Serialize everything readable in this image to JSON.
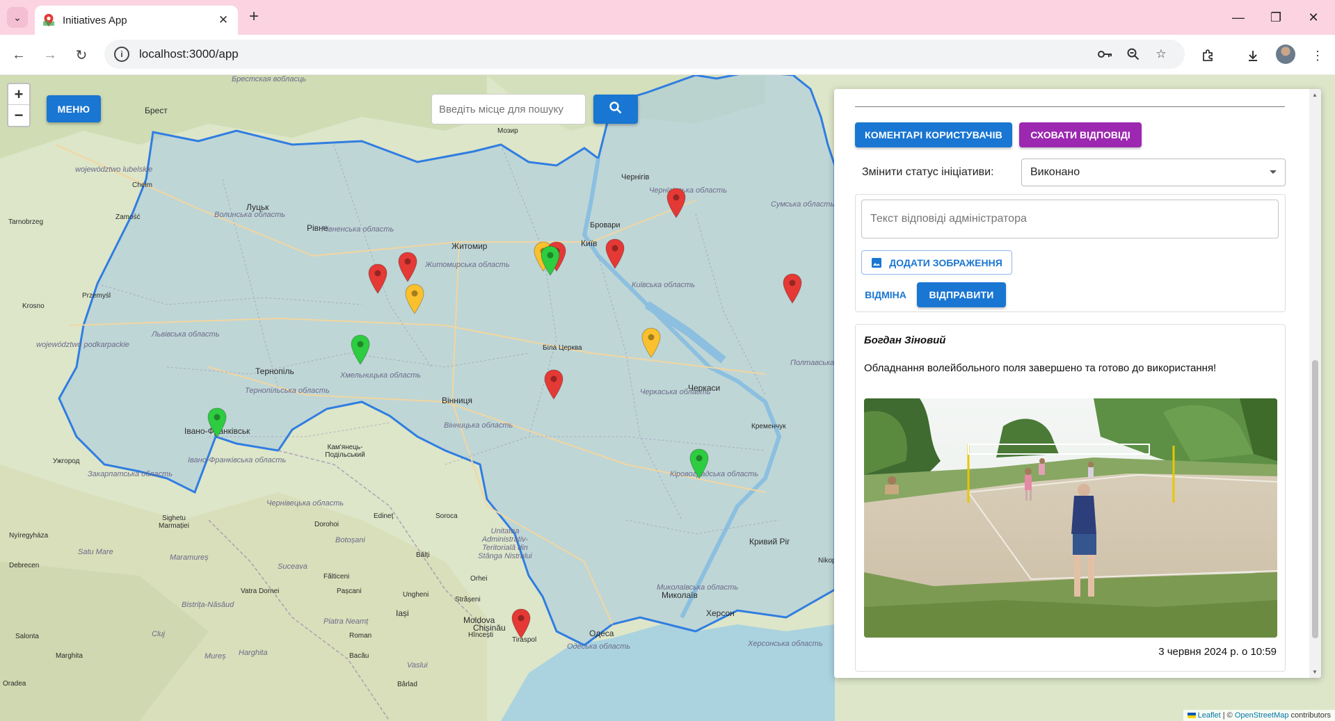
{
  "browser": {
    "tab_title": "Initiatives App",
    "url": "localhost:3000/app"
  },
  "map": {
    "zoom_in": "+",
    "zoom_out": "−",
    "menu_label": "МЕНЮ",
    "search_placeholder": "Введіть місце для пошуку",
    "attribution_leaflet": "Leaflet",
    "attribution_sep": " | © ",
    "attribution_osm": "OpenStreetMap",
    "attribution_tail": " contributors",
    "cities": [
      {
        "name": "Брест"
      },
      {
        "name": "Луцьк"
      },
      {
        "name": "Рівне"
      },
      {
        "name": "Житомир"
      },
      {
        "name": "Київ"
      },
      {
        "name": "Бровари"
      },
      {
        "name": "Чернігів"
      },
      {
        "name": "Тернопіль"
      },
      {
        "name": "Вінниця"
      },
      {
        "name": "Біла Церква"
      },
      {
        "name": "Черкаси"
      },
      {
        "name": "Івано-Франківськ"
      },
      {
        "name": "Кам'янець-Подільський"
      },
      {
        "name": "Ужгород"
      },
      {
        "name": "Кременчук"
      },
      {
        "name": "Кривий Ріг"
      },
      {
        "name": "Миколаїв"
      },
      {
        "name": "Херсон"
      },
      {
        "name": "Одеса"
      },
      {
        "name": "Мозир"
      },
      {
        "name": "Chełm"
      },
      {
        "name": "Zamość"
      },
      {
        "name": "Tarnobrzeg"
      },
      {
        "name": "Przemyśl"
      },
      {
        "name": "Krosno"
      },
      {
        "name": "Sighetu Marmației"
      },
      {
        "name": "Nyíregyháza"
      },
      {
        "name": "Debrecen"
      },
      {
        "name": "Satu Mare"
      },
      {
        "name": "Suceava"
      },
      {
        "name": "Botoșani"
      },
      {
        "name": "Bălți"
      },
      {
        "name": "Iași"
      },
      {
        "name": "Chișinău"
      },
      {
        "name": "Moldova"
      },
      {
        "name": "Tiraspol"
      },
      {
        "name": "Bacău"
      },
      {
        "name": "Edineț"
      },
      {
        "name": "Soroca"
      },
      {
        "name": "Orhei"
      },
      {
        "name": "Ungheni"
      },
      {
        "name": "Cluj"
      },
      {
        "name": "Oradea"
      },
      {
        "name": "Marghita"
      },
      {
        "name": "Roman"
      },
      {
        "name": "Vaslui"
      },
      {
        "name": "Hîncești"
      },
      {
        "name": "Bârlad"
      },
      {
        "name": "Salonta"
      },
      {
        "name": "Bistrița-Năsăud"
      },
      {
        "name": "Piatra Neamț"
      },
      {
        "name": "Harghita"
      },
      {
        "name": "Mureș"
      },
      {
        "name": "Vatra Dornei"
      },
      {
        "name": "Fălticeni"
      },
      {
        "name": "Pașcani"
      },
      {
        "name": "Dorohoi"
      },
      {
        "name": "Maramureș"
      },
      {
        "name": "Strășeni"
      },
      {
        "name": "Nikopol"
      }
    ],
    "regions": [
      {
        "name": "Волинська область"
      },
      {
        "name": "Рівненська область"
      },
      {
        "name": "Житомирська область"
      },
      {
        "name": "Чернігівська область"
      },
      {
        "name": "Сумська область"
      },
      {
        "name": "Київська область"
      },
      {
        "name": "Львівська область"
      },
      {
        "name": "Тернопільська область"
      },
      {
        "name": "Хмельницька область"
      },
      {
        "name": "Вінницька область"
      },
      {
        "name": "Черкаська область"
      },
      {
        "name": "Полтавська область"
      },
      {
        "name": "Івано-Франківська область"
      },
      {
        "name": "Закарпатська область"
      },
      {
        "name": "Чернівецька область"
      },
      {
        "name": "Кіровоградська область"
      },
      {
        "name": "Миколаївська область"
      },
      {
        "name": "Одеська область"
      },
      {
        "name": "Херсонська область"
      },
      {
        "name": "Брестская вобласць"
      },
      {
        "name": "województwo lubelskie"
      },
      {
        "name": "województwo podkarpackie"
      },
      {
        "name": "Unitatea Administrativ-Teritorială din Stânga Nistrului"
      }
    ],
    "pins": [
      {
        "status": "red"
      },
      {
        "status": "red"
      },
      {
        "status": "red"
      },
      {
        "status": "yellow"
      },
      {
        "status": "yellow"
      },
      {
        "status": "red"
      },
      {
        "status": "green"
      },
      {
        "status": "red"
      },
      {
        "status": "red"
      },
      {
        "status": "green"
      },
      {
        "status": "yellow"
      },
      {
        "status": "red"
      },
      {
        "status": "green"
      },
      {
        "status": "green"
      },
      {
        "status": "red"
      }
    ],
    "colors": {
      "red": "#e53935",
      "yellow": "#fbc02d",
      "green": "#2ecc40",
      "blue": "#1976d2"
    }
  },
  "panel": {
    "btn_comments": "КОМЕНТАРІ КОРИСТУВАЧІВ",
    "btn_hide_replies": "СХОВАТИ ВІДПОВІДІ",
    "status_label": "Змінити статус ініціативи:",
    "status_value": "Виконано",
    "reply_placeholder": "Текст відповіді адміністратора",
    "btn_add_image": "ДОДАТИ ЗОБРАЖЕННЯ",
    "btn_cancel": "ВІДМІНА",
    "btn_send": "ВІДПРАВИТИ",
    "reply": {
      "author": "Богдан Зіновий",
      "text": "Обладнання волейбольного поля завершено та готово до використання!",
      "date": "3 червня 2024 р. о 10:59"
    }
  }
}
